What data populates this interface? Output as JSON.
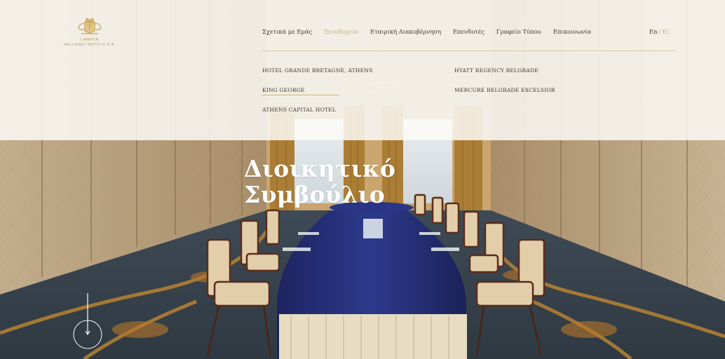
{
  "brand": {
    "name_line1": "LAMPSA",
    "name_line2": "HELLENIC HOTELS S.A.",
    "logo_icon": "royal-crest-icon",
    "gold": "#c8b27c"
  },
  "nav": {
    "items": [
      {
        "label": "Σχετικά με Εμάς",
        "active": false
      },
      {
        "label": "Ξενοδοχεία",
        "active": true
      },
      {
        "label": "Εταιρική Διακυβέρνηση",
        "active": false
      },
      {
        "label": "Επενδυτές",
        "active": false
      },
      {
        "label": "Γραφείο Τύπου",
        "active": false
      },
      {
        "label": "Επικοινωνία",
        "active": false
      }
    ],
    "lang_en": "En",
    "lang_sep": "/",
    "lang_el": "El"
  },
  "hotels_menu": {
    "col1": [
      "HOTEL GRANDE BRETAGNE, ATHENS",
      "KING GEORGE",
      "ATHENS CAPITAL HOTEL"
    ],
    "col2": [
      "HYATT REGENCY BELGRADE",
      "MERCURE BELGRADE EXCELSIOR"
    ]
  },
  "hero": {
    "title_line1": "Διοικητικό",
    "title_line2": "Συμβούλιο",
    "scroll_icon": "scroll-down-arrow-icon"
  }
}
